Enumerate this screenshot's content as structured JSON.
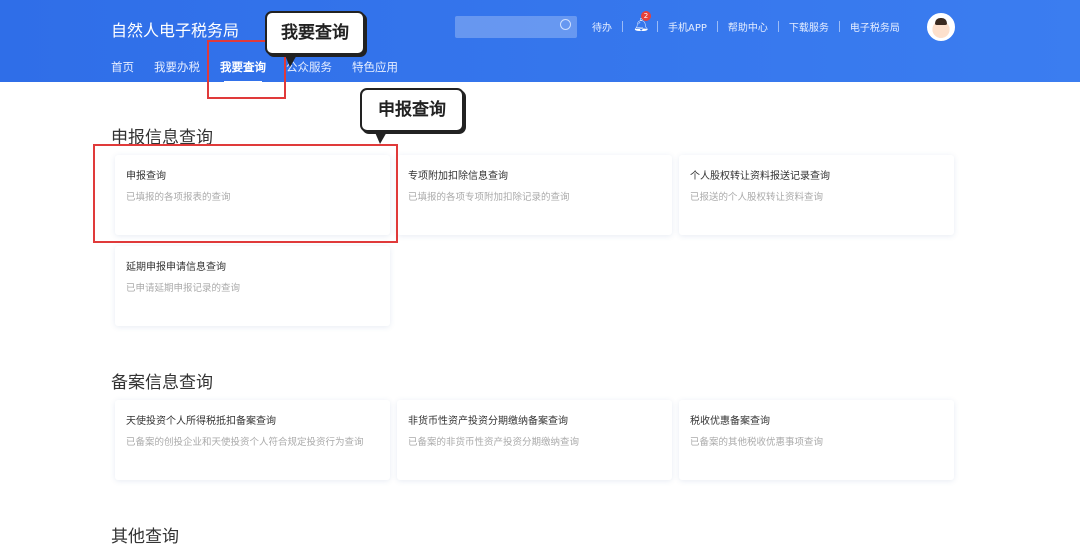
{
  "header": {
    "title": "自然人电子税务局",
    "nav": [
      "首页",
      "我要办税",
      "我要查询",
      "公众服务",
      "特色应用"
    ],
    "active_nav": 2,
    "tools": {
      "todo": "待办",
      "bell_badge": "2",
      "app": "手机APP",
      "help": "帮助中心",
      "download": "下载服务",
      "bureau": "电子税务局"
    }
  },
  "annotations": {
    "nav_callout": "我要查询",
    "card_callout": "申报查询"
  },
  "sections": [
    {
      "title": "申报信息查询",
      "cards": [
        {
          "title": "申报查询",
          "desc": "已填报的各项报表的查询"
        },
        {
          "title": "专项附加扣除信息查询",
          "desc": "已填报的各项专项附加扣除记录的查询"
        },
        {
          "title": "个人股权转让资料报送记录查询",
          "desc": "已报送的个人股权转让资料查询"
        },
        {
          "title": "延期申报申请信息查询",
          "desc": "已申请延期申报记录的查询"
        }
      ]
    },
    {
      "title": "备案信息查询",
      "cards": [
        {
          "title": "天使投资个人所得税抵扣备案查询",
          "desc": "已备案的创投企业和天使投资个人符合规定投资行为查询"
        },
        {
          "title": "非货币性资产投资分期缴纳备案查询",
          "desc": "已备案的非货币性资产投资分期缴纳查询"
        },
        {
          "title": "税收优惠备案查询",
          "desc": "已备案的其他税收优惠事项查询"
        }
      ]
    },
    {
      "title": "其他查询",
      "cards": []
    }
  ]
}
